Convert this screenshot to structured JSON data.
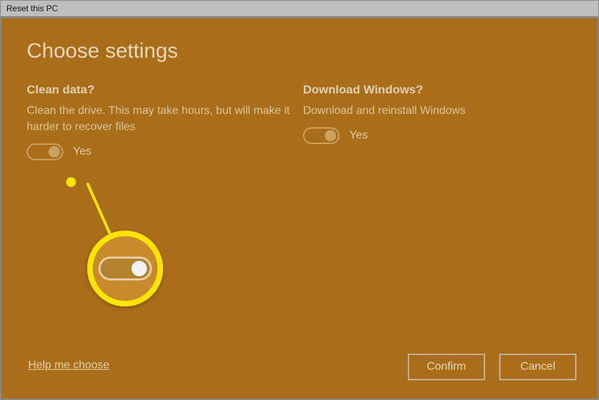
{
  "window": {
    "title": "Reset this PC"
  },
  "page": {
    "heading": "Choose settings"
  },
  "options": {
    "clean": {
      "title": "Clean data?",
      "desc": "Clean the drive. This may take hours, but will make it harder to recover files",
      "state_label": "Yes"
    },
    "download": {
      "title": "Download Windows?",
      "desc": "Download and reinstall Windows",
      "state_label": "Yes"
    }
  },
  "footer": {
    "help_link": "Help me choose",
    "confirm": "Confirm",
    "cancel": "Cancel"
  }
}
